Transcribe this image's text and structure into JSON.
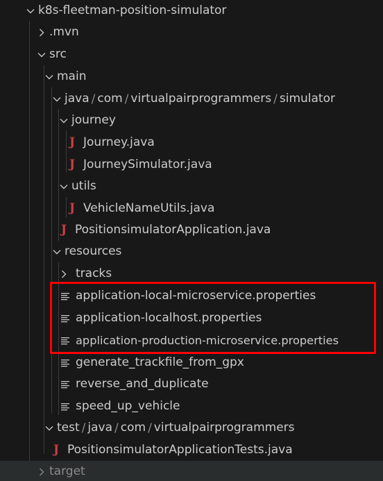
{
  "rows": [
    {
      "label": "k8s-fleetman-position-simulator",
      "kind": "folder-open"
    },
    {
      "label": ".mvn",
      "kind": "folder-closed"
    },
    {
      "label": "src",
      "kind": "folder-open"
    },
    {
      "label": "main",
      "kind": "folder-open"
    },
    {
      "segments": [
        "java",
        "com",
        "virtualpairprogrammers",
        "simulator"
      ],
      "kind": "folder-open"
    },
    {
      "label": "journey",
      "kind": "folder-open"
    },
    {
      "label": "Journey.java",
      "kind": "java"
    },
    {
      "label": "JourneySimulator.java",
      "kind": "java"
    },
    {
      "label": "utils",
      "kind": "folder-open"
    },
    {
      "label": "VehicleNameUtils.java",
      "kind": "java"
    },
    {
      "label": "PositionsimulatorApplication.java",
      "kind": "java"
    },
    {
      "label": "resources",
      "kind": "folder-open"
    },
    {
      "label": "tracks",
      "kind": "folder-closed"
    },
    {
      "label": "application-local-microservice.properties",
      "kind": "properties"
    },
    {
      "label": "application-localhost.properties",
      "kind": "properties"
    },
    {
      "label": "application-production-microservice.properties",
      "kind": "properties"
    },
    {
      "label": "generate_trackfile_from_gpx",
      "kind": "file"
    },
    {
      "label": "reverse_and_duplicate",
      "kind": "file"
    },
    {
      "label": "speed_up_vehicle",
      "kind": "file"
    },
    {
      "segments": [
        "test",
        "java",
        "com",
        "virtualpairprogrammers"
      ],
      "kind": "folder-open"
    },
    {
      "label": "PositionsimulatorApplicationTests.java",
      "kind": "java"
    },
    {
      "label": "target",
      "kind": "folder-closed"
    }
  ],
  "path_separator": "/",
  "java_icon_glyph": "J",
  "colors": {
    "background": "#181818",
    "text": "#cccccc",
    "java_icon": "#cc3e44",
    "highlight_box": "#ff0000",
    "dimmed_text": "#8b8b8b"
  }
}
